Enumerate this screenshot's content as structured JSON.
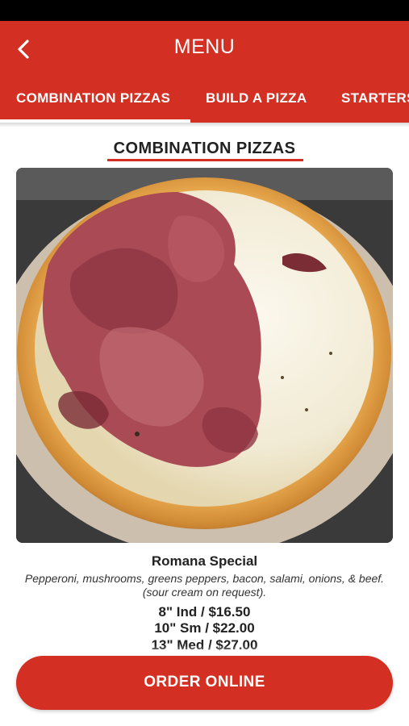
{
  "header": {
    "title": "MENU",
    "back_icon": "chevron-left-icon"
  },
  "tabs": [
    {
      "label": "COMBINATION PIZZAS",
      "active": true
    },
    {
      "label": "BUILD A PIZZA",
      "active": false
    },
    {
      "label": "STARTERS",
      "active": false
    }
  ],
  "section": {
    "title": "COMBINATION PIZZAS"
  },
  "item": {
    "name": "Romana Special",
    "description": "Pepperoni, mushrooms, greens peppers, bacon, salami, onions, & beef. (sour cream on request).",
    "prices": [
      "8\" Ind / $16.50",
      "10\" Sm / $22.00",
      "13\" Med / $27.00"
    ]
  },
  "cta": {
    "label": "ORDER ONLINE"
  },
  "colors": {
    "brand_red": "#d32f23",
    "text_dark": "#222222",
    "white": "#ffffff"
  }
}
